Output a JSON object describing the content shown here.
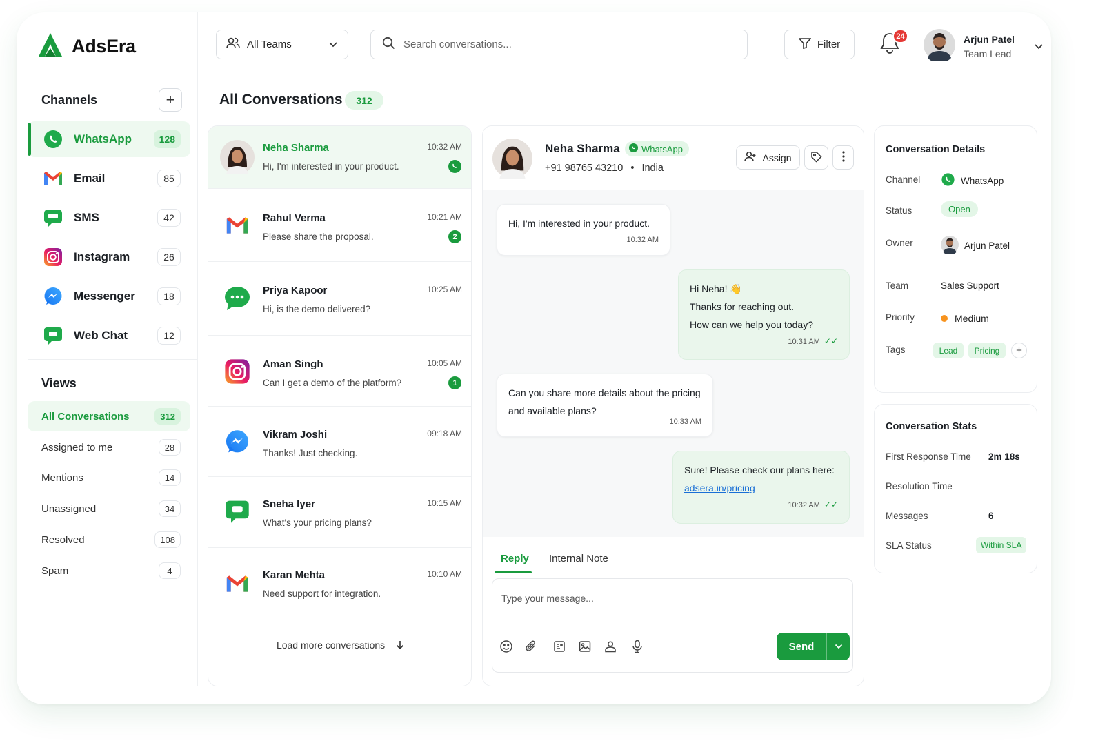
{
  "brand": {
    "name": "AdsEra",
    "color": "#1a9b3e"
  },
  "colors": {
    "accent": "#1a9b3e",
    "accent_bg": "#e3f6e7",
    "badge_red": "#e53935",
    "priority_medium": "#f7931e"
  },
  "sidebar": {
    "channels_title": "Channels",
    "channels": [
      {
        "label": "WhatsApp",
        "count": "128",
        "icon": "whatsapp-icon",
        "active": true
      },
      {
        "label": "Email",
        "count": "85",
        "icon": "gmail-icon"
      },
      {
        "label": "SMS",
        "count": "42",
        "icon": "sms-icon"
      },
      {
        "label": "Instagram",
        "count": "26",
        "icon": "instagram-icon"
      },
      {
        "label": "Messenger",
        "count": "18",
        "icon": "messenger-icon"
      },
      {
        "label": "Web Chat",
        "count": "12",
        "icon": "webchat-icon"
      }
    ],
    "views_title": "Views",
    "views": [
      {
        "label": "All Conversations",
        "count": "312",
        "active": true
      },
      {
        "label": "Assigned to me",
        "count": "28"
      },
      {
        "label": "Mentions",
        "count": "14"
      },
      {
        "label": "Unassigned",
        "count": "34"
      },
      {
        "label": "Resolved",
        "count": "108"
      },
      {
        "label": "Spam",
        "count": "4"
      }
    ]
  },
  "topbar": {
    "teams_label": "All Teams",
    "search_placeholder": "Search conversations...",
    "filter_label": "Filter",
    "notifications_count": "24",
    "user": {
      "name": "Arjun Patel",
      "role": "Team Lead"
    }
  },
  "list": {
    "title": "All Conversations",
    "count": "312",
    "load_more": "Load more conversations",
    "items": [
      {
        "name": "Neha Sharma",
        "preview": "Hi, I'm interested in your product.",
        "time": "10:32 AM",
        "channel": "whatsapp-icon",
        "avatar": "person-female-photo",
        "badge": "",
        "active": true
      },
      {
        "name": "Rahul Verma",
        "preview": "Please share the proposal.",
        "time": "10:21 AM",
        "channel": "gmail-icon",
        "badge": "2"
      },
      {
        "name": "Priya Kapoor",
        "preview": "Hi, is the demo delivered?",
        "time": "10:25 AM",
        "channel": "sms-icon",
        "badge": ""
      },
      {
        "name": "Aman Singh",
        "preview": "Can I get a demo of the platform?",
        "time": "10:05 AM",
        "channel": "instagram-icon",
        "badge": "1"
      },
      {
        "name": "Vikram Joshi",
        "preview": "Thanks! Just checking.",
        "time": "09:18 AM",
        "channel": "messenger-icon",
        "badge": ""
      },
      {
        "name": "Sneha Iyer",
        "preview": "What's your pricing plans?",
        "time": "10:15 AM",
        "channel": "webchat-icon",
        "badge": ""
      },
      {
        "name": "Karan Mehta",
        "preview": "Need support for integration.",
        "time": "10:10 AM",
        "channel": "gmail-icon",
        "badge": ""
      }
    ]
  },
  "chat": {
    "contact": {
      "name": "Neha Sharma",
      "channel": "WhatsApp",
      "phone": "+91 98765 43210",
      "location": "India"
    },
    "assign_label": "Assign",
    "messages": [
      {
        "dir": "in",
        "lines": [
          "Hi, I'm interested in your product."
        ],
        "time": "10:32 AM"
      },
      {
        "dir": "out",
        "lines": [
          "Hi Neha! 👋",
          "Thanks for reaching out.",
          "How can we help you today?"
        ],
        "time": "10:31 AM",
        "read": true
      },
      {
        "dir": "in",
        "lines": [
          "Can you share more details about the pricing",
          "and available plans?"
        ],
        "time": "10:33 AM"
      },
      {
        "dir": "out",
        "lines": [
          "Sure! Please check our plans here:"
        ],
        "link": "adsera.in/pricing",
        "time": "10:32 AM",
        "read": true
      }
    ],
    "tabs": [
      "Reply",
      "Internal Note"
    ],
    "active_tab": "Reply",
    "composer_placeholder": "Type your message...",
    "send_label": "Send"
  },
  "details": {
    "title": "Conversation Details",
    "channel_label": "Channel",
    "channel_value": "WhatsApp",
    "status_label": "Status",
    "status_value": "Open",
    "owner_label": "Owner",
    "owner_value": "Arjun Patel",
    "team_label": "Team",
    "team_value": "Sales Support",
    "priority_label": "Priority",
    "priority_value": "Medium",
    "tags_label": "Tags",
    "tags": [
      "Lead",
      "Pricing"
    ]
  },
  "stats": {
    "title": "Conversation Stats",
    "rows": [
      {
        "label": "First Response Time",
        "value": "2m 18s"
      },
      {
        "label": "Resolution Time",
        "value": "—"
      },
      {
        "label": "Messages",
        "value": "6"
      },
      {
        "label": "SLA Status",
        "value": "Within SLA"
      }
    ]
  }
}
